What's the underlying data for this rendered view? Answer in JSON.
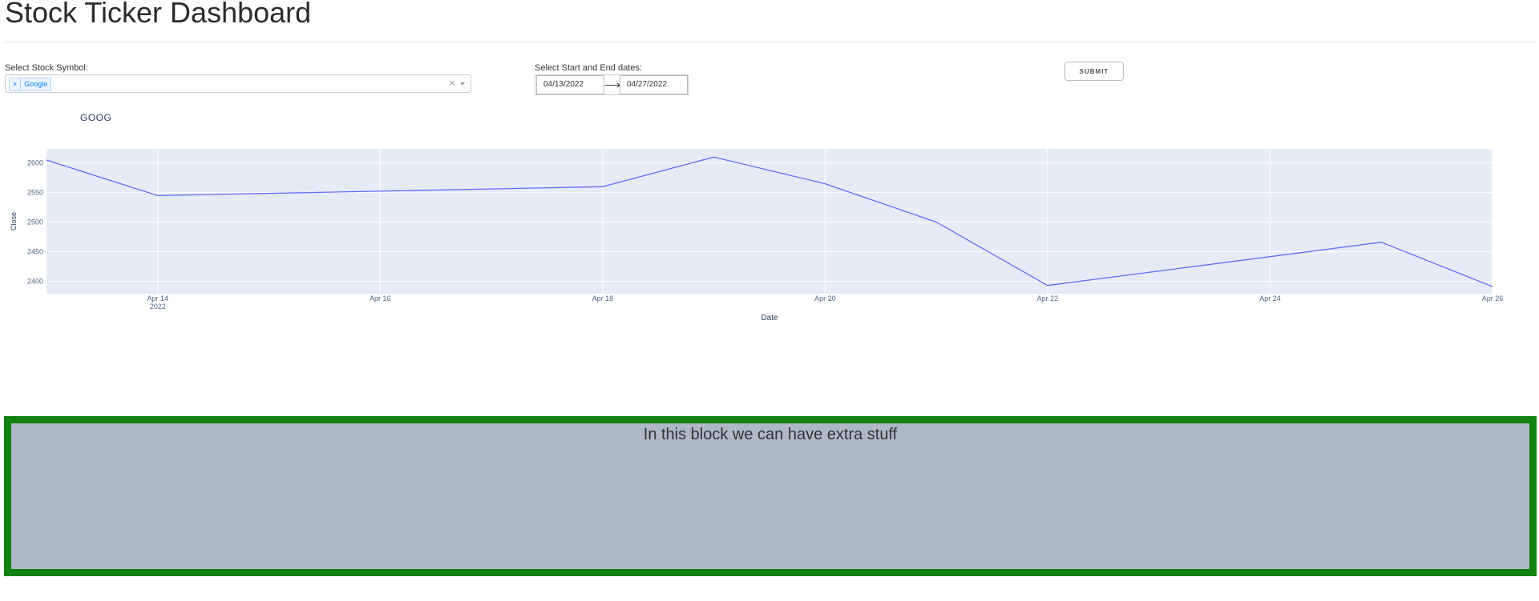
{
  "page": {
    "title": "Stock Ticker Dashboard"
  },
  "controls": {
    "symbol_label": "Select Stock Symbol:",
    "selected_chip": {
      "remove": "×",
      "label": "Google"
    },
    "clear_icon": "×",
    "date_label": "Select Start and End dates:",
    "start_date": "04/13/2022",
    "end_date": "04/27/2022",
    "arrow": "⟶",
    "submit_label": "SUBMIT"
  },
  "colors": {
    "plot_bg": "#e5ecf6",
    "line": "#636efa",
    "block_border": "#118211",
    "block_bg": "#adb8c8"
  },
  "chart_data": {
    "type": "line",
    "title": "GOOG",
    "xlabel": "Date",
    "ylabel": "Close",
    "x": [
      "2022-04-13",
      "2022-04-14",
      "2022-04-18",
      "2022-04-19",
      "2022-04-20",
      "2022-04-21",
      "2022-04-22",
      "2022-04-25",
      "2022-04-26"
    ],
    "series": [
      {
        "values": [
          2605,
          2545,
          2560,
          2610,
          2565,
          2500,
          2393,
          2466,
          2391
        ]
      }
    ],
    "xlim": [
      "2022-04-13",
      "2022-04-26"
    ],
    "ylim": [
      2379,
      2624
    ],
    "yticks": [
      2400,
      2450,
      2500,
      2550,
      2600
    ],
    "ytick_labels": [
      "2400",
      "2450",
      "2500",
      "2550",
      "2600"
    ],
    "xticks": [
      "2022-04-14",
      "2022-04-16",
      "2022-04-18",
      "2022-04-20",
      "2022-04-22",
      "2022-04-24",
      "2022-04-26"
    ],
    "xtick_labels": [
      "Apr 14",
      "Apr 16",
      "Apr 18",
      "Apr 20",
      "Apr 22",
      "Apr 24",
      "Apr 26"
    ],
    "xtick_year": "2022",
    "grid": true
  },
  "extra_block": {
    "text": "In this block we can have extra stuff"
  }
}
